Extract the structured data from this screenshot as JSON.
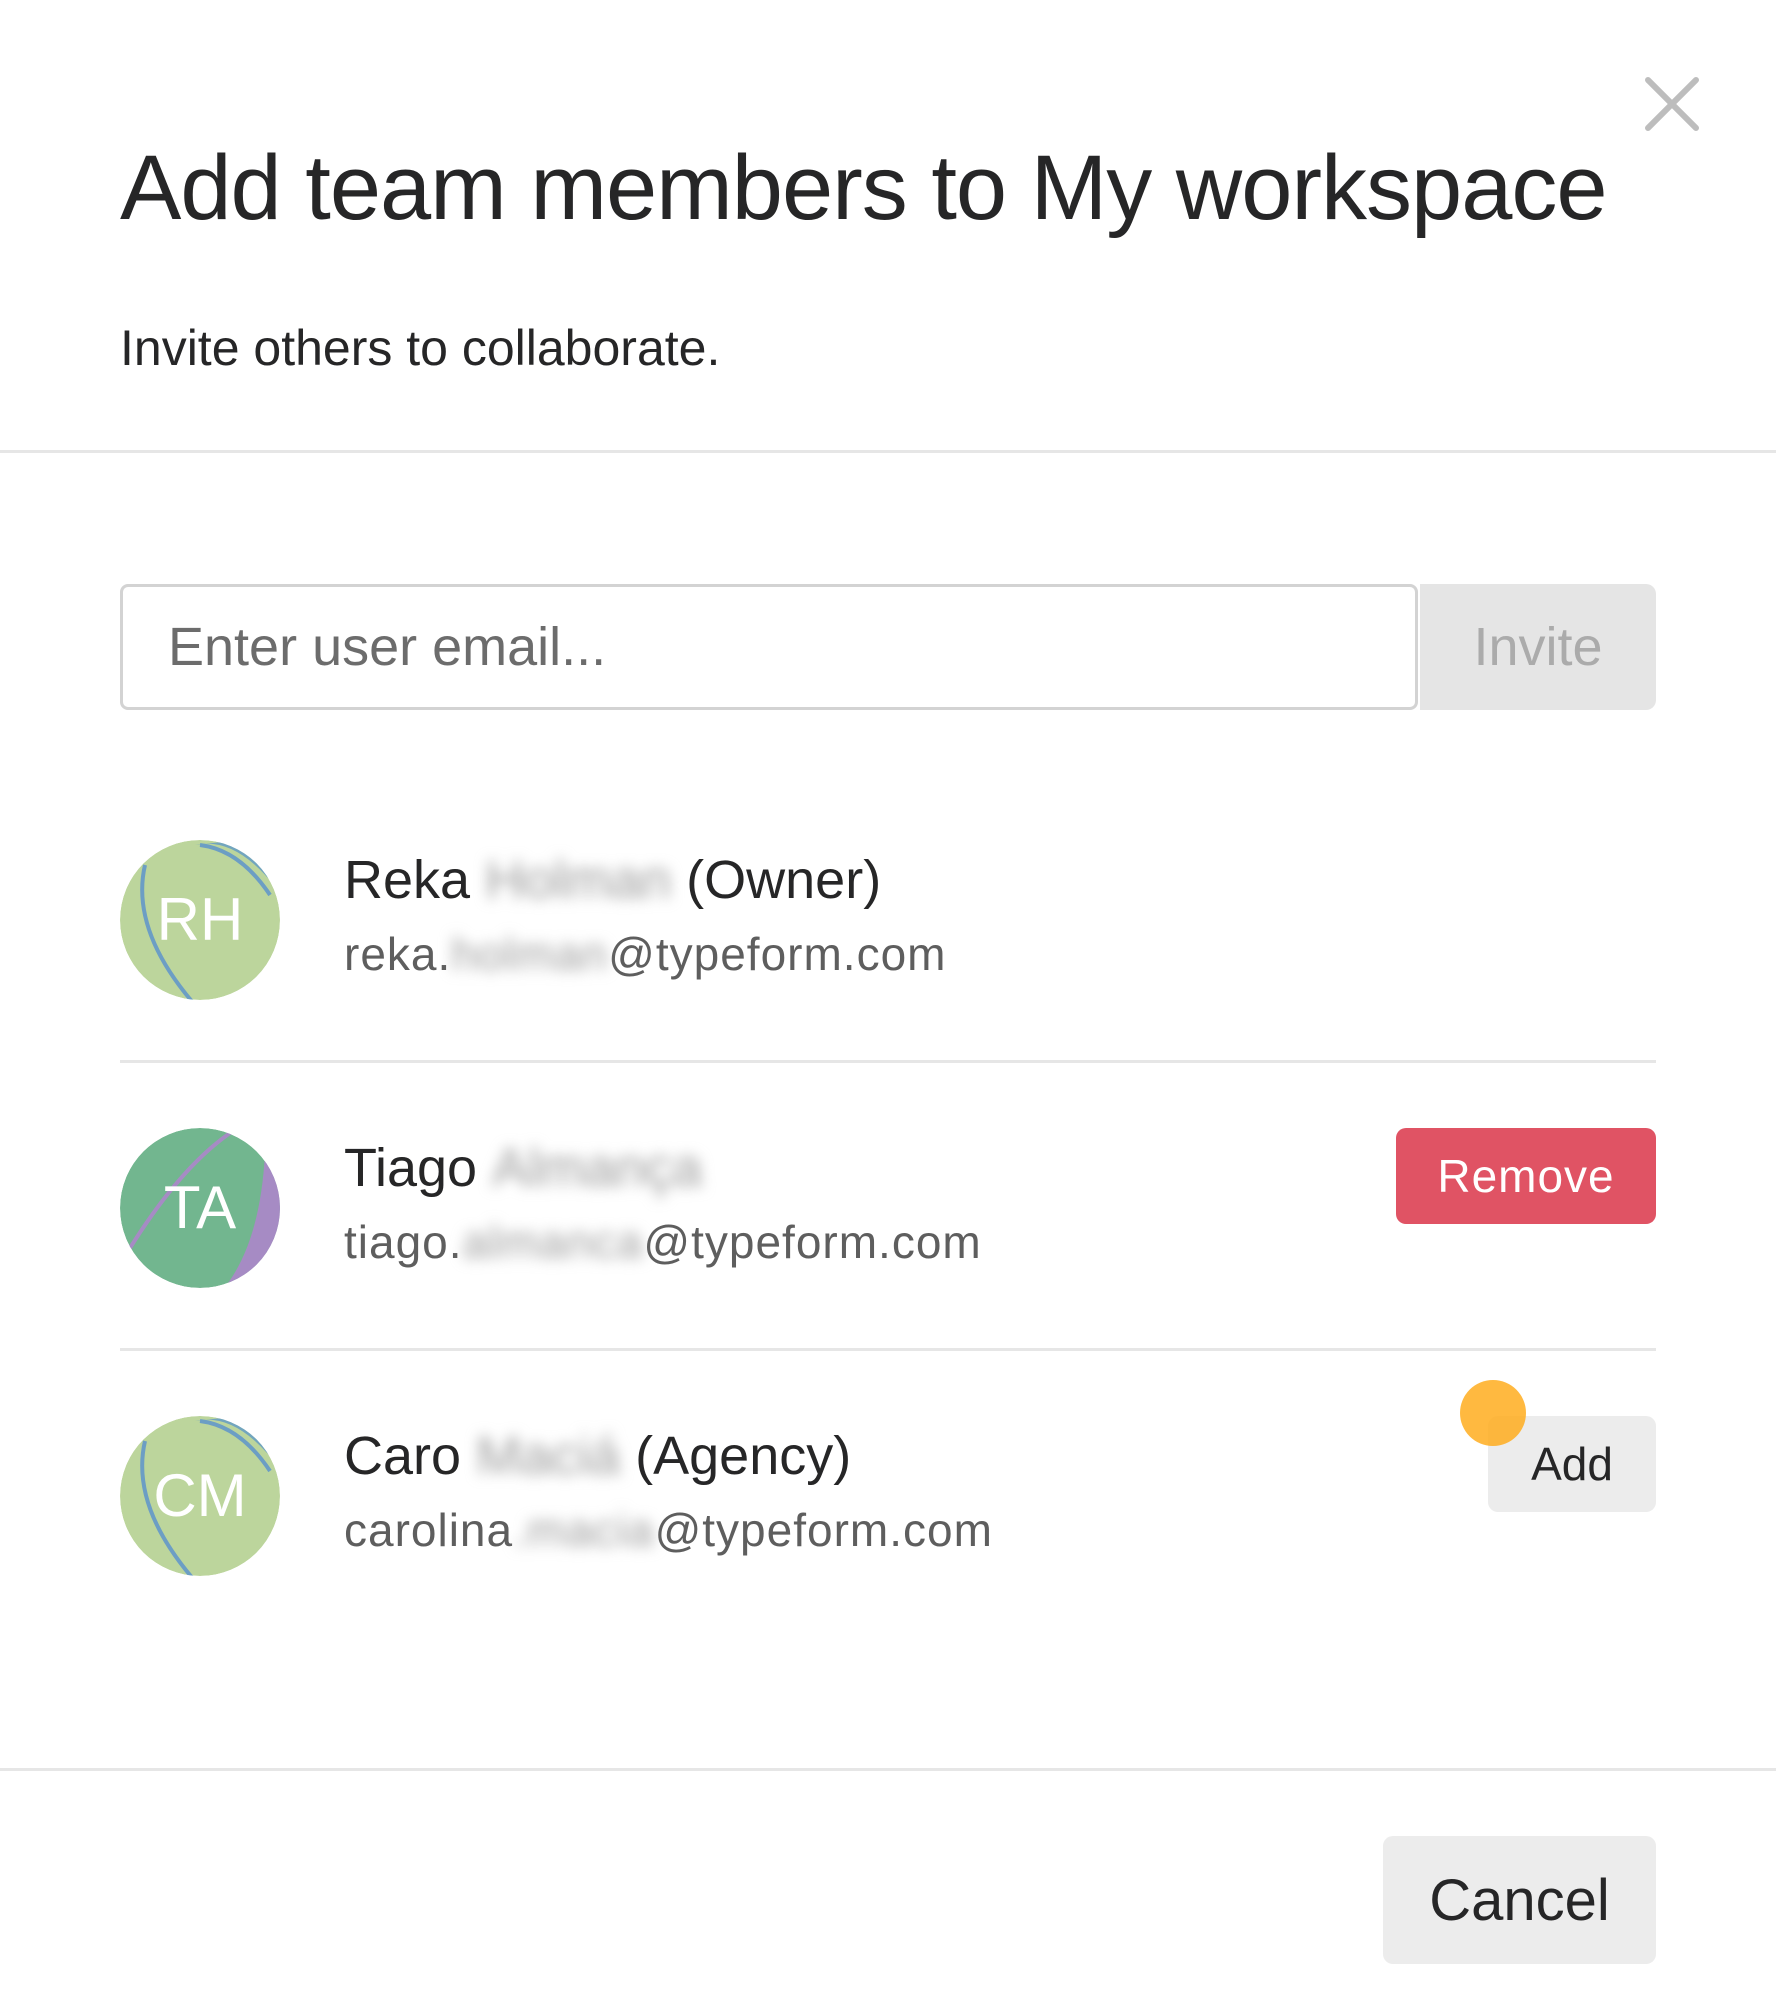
{
  "modal": {
    "title": "Add team members to My workspace",
    "subtitle": "Invite others to collaborate.",
    "close_icon": "close-icon"
  },
  "invite": {
    "placeholder": "Enter user email...",
    "value": "",
    "button_label": "Invite"
  },
  "members": [
    {
      "initials": "RH",
      "first_name": "Reka",
      "last_name_redacted": "Holman",
      "role": "(Owner)",
      "email_prefix": "reka.",
      "email_redacted": "holman",
      "email_domain": "@typeform.com",
      "avatar_colors": {
        "base": "#bcd59c",
        "accent": "#72a5bf",
        "line": "#6c9ec4"
      }
    },
    {
      "initials": "TA",
      "first_name": "Tiago",
      "last_name_redacted": "Almança",
      "role": "",
      "email_prefix": "tiago.",
      "email_redacted": "almanca",
      "email_domain": "@typeform.com",
      "action_label": "Remove",
      "avatar_colors": {
        "base": "#72b68f",
        "accent": "#a68bc4",
        "line": "#a68bc4"
      }
    },
    {
      "initials": "CM",
      "first_name": "Caro",
      "last_name_redacted": "Maciá",
      "role": "(Agency)",
      "email_prefix": "carolina",
      "email_redacted": ".macia",
      "email_domain": "@typeform.com",
      "action_label": "Add",
      "avatar_colors": {
        "base": "#bcd59c",
        "accent": "#72a5bf",
        "line": "#6c9ec4"
      }
    }
  ],
  "footer": {
    "cancel_label": "Cancel"
  },
  "colors": {
    "remove_button": "#e05364",
    "cursor_indicator": "#ffad1e"
  }
}
